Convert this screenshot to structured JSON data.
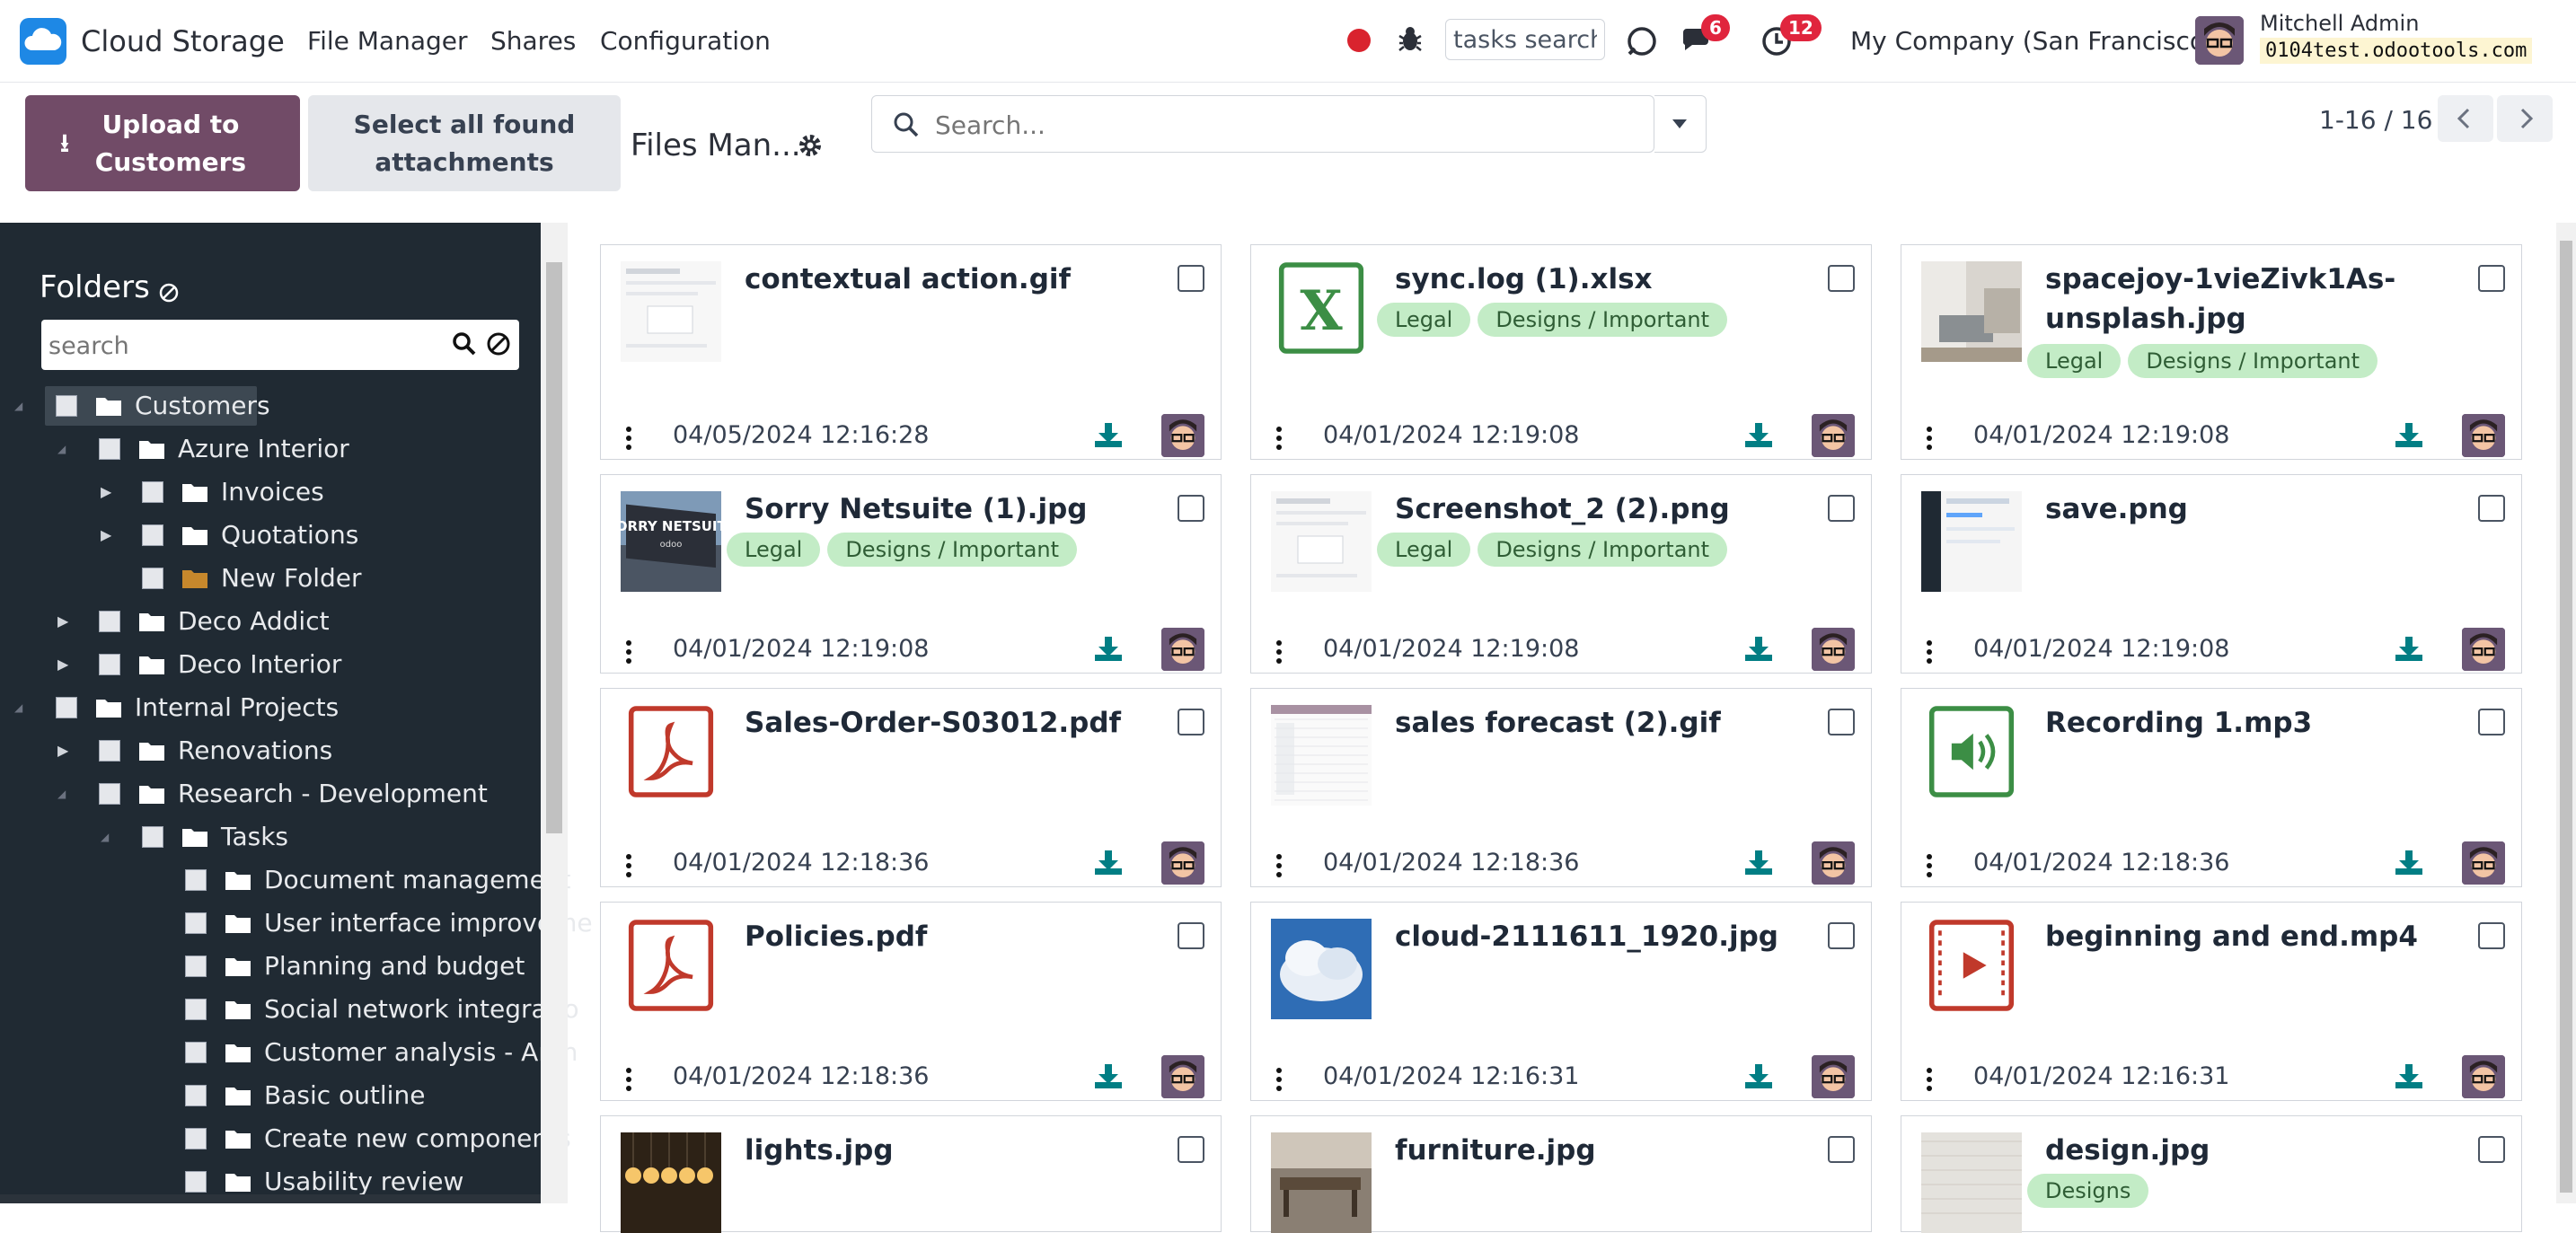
{
  "app": {
    "name": "Cloud Storage",
    "brand_color": "#714b67"
  },
  "menu": [
    "File Manager",
    "Shares",
    "Configuration"
  ],
  "systray": {
    "tasks_search_placeholder": "tasks search",
    "messages_badge": "6",
    "activities_badge": "12",
    "company": "My Company (San Francisco)",
    "user_name": "Mitchell Admin",
    "database": "0104test.odootools.com"
  },
  "control": {
    "upload_label": "Upload to Customers",
    "select_all_label": "Select all found attachments",
    "breadcrumb": "Files Man...",
    "search_placeholder": "Search...",
    "pager": "1-16 / 16"
  },
  "sidebar": {
    "title": "Folders",
    "search_placeholder": "search",
    "tree": [
      {
        "label": "Customers",
        "expanded": true,
        "selected": true
      },
      {
        "label": "Azure Interior",
        "expanded": true
      },
      {
        "label": "Invoices",
        "expanded": false
      },
      {
        "label": "Quotations",
        "expanded": false
      },
      {
        "label": "New Folder",
        "leaf": true
      },
      {
        "label": "Deco Addict",
        "expanded": false
      },
      {
        "label": "Deco Interior",
        "expanded": false
      },
      {
        "label": "Internal Projects",
        "expanded": true
      },
      {
        "label": "Renovations",
        "expanded": false
      },
      {
        "label": "Research - Development",
        "expanded": true
      },
      {
        "label": "Tasks",
        "expanded": true
      },
      {
        "label": "Document management"
      },
      {
        "label": "User interface improveme"
      },
      {
        "label": "Planning and budget"
      },
      {
        "label": "Social network integratio"
      },
      {
        "label": "Customer analysis - Arch"
      },
      {
        "label": "Basic outline"
      },
      {
        "label": "Create new components"
      },
      {
        "label": "Usability review"
      }
    ]
  },
  "files": [
    {
      "name": "contextual action.gif",
      "tags": [],
      "date": "04/05/2024 12:16:28",
      "thumb": "screenshot-thumb"
    },
    {
      "name": "sync.log (1).xlsx",
      "tags": [
        "Legal",
        "Designs / Important"
      ],
      "date": "04/01/2024 12:19:08",
      "thumb": "excel-icon"
    },
    {
      "name": "spacejoy-1vieZivk1As-unsplash.jpg",
      "tags": [
        "Legal",
        "Designs / Important"
      ],
      "date": "04/01/2024 12:19:08",
      "thumb": "room-photo"
    },
    {
      "name": "Sorry Netsuite (1).jpg",
      "tags": [
        "Legal",
        "Designs / Important"
      ],
      "date": "04/01/2024 12:19:08",
      "thumb": "billboard-photo"
    },
    {
      "name": "Screenshot_2 (2).png",
      "tags": [
        "Legal",
        "Designs / Important"
      ],
      "date": "04/01/2024 12:19:08",
      "thumb": "screenshot-thumb"
    },
    {
      "name": "save.png",
      "tags": [],
      "date": "04/01/2024 12:19:08",
      "thumb": "screenshot-dark-thumb"
    },
    {
      "name": "Sales-Order-S03012.pdf",
      "tags": [],
      "date": "04/01/2024 12:18:36",
      "thumb": "pdf-icon"
    },
    {
      "name": "sales forecast (2).gif",
      "tags": [],
      "date": "04/01/2024 12:18:36",
      "thumb": "spreadsheet-thumb"
    },
    {
      "name": "Recording 1.mp3",
      "tags": [],
      "date": "04/01/2024 12:18:36",
      "thumb": "audio-icon"
    },
    {
      "name": "Policies.pdf",
      "tags": [],
      "date": "04/01/2024 12:18:36",
      "thumb": "pdf-icon"
    },
    {
      "name": "cloud-2111611_1920.jpg",
      "tags": [],
      "date": "04/01/2024 12:16:31",
      "thumb": "cloud-photo"
    },
    {
      "name": "beginning and end.mp4",
      "tags": [],
      "date": "04/01/2024 12:16:31",
      "thumb": "video-icon"
    },
    {
      "name": "lights.jpg",
      "tags": [],
      "date": "",
      "thumb": "lights-photo"
    },
    {
      "name": "furniture.jpg",
      "tags": [],
      "date": "",
      "thumb": "furniture-photo"
    },
    {
      "name": "design.jpg",
      "tags": [
        "Designs"
      ],
      "date": "",
      "thumb": "wall-photo"
    }
  ]
}
